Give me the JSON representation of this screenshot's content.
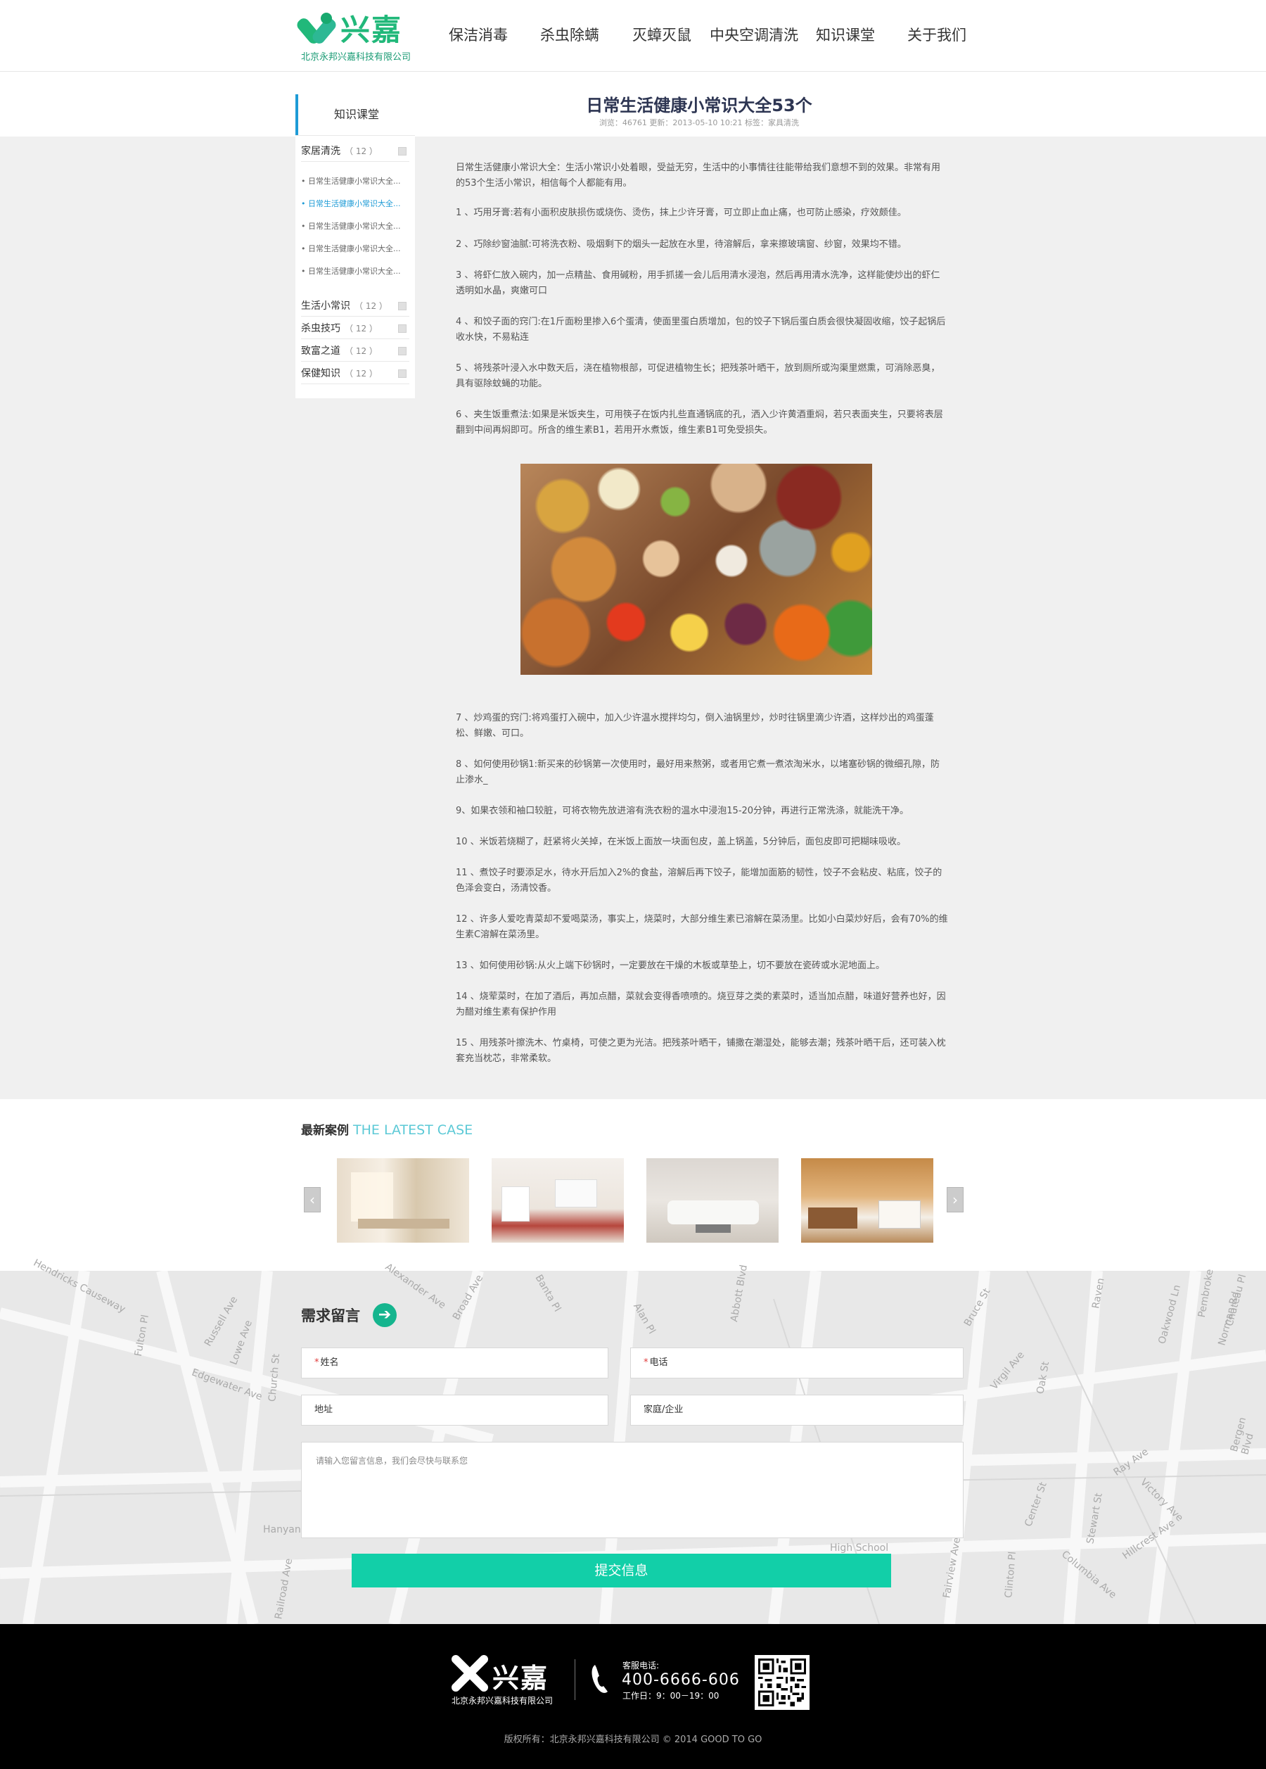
{
  "header": {
    "logo_text": "兴嘉",
    "logo_sub": "北京永邦兴嘉科技有限公司",
    "nav": [
      "保洁消毒",
      "杀虫除螨",
      "灭蟑灭鼠",
      "中央空调清洗",
      "知识课堂",
      "关于我们"
    ]
  },
  "sidebar": {
    "title": "知识课堂",
    "categories": [
      {
        "label": "家居清洗",
        "count": "（ 12 ）"
      },
      {
        "label": "生活小常识",
        "count": "（ 12 ）"
      },
      {
        "label": "杀虫技巧",
        "count": "（ 12 ）"
      },
      {
        "label": "致富之道",
        "count": "（ 12 ）"
      },
      {
        "label": "保健知识",
        "count": "（ 12 ）"
      }
    ],
    "sub_items": [
      "• 日常生活健康小常识大全...",
      "• 日常生活健康小常识大全...",
      "• 日常生活健康小常识大全...",
      "• 日常生活健康小常识大全...",
      "• 日常生活健康小常识大全..."
    ]
  },
  "article": {
    "title": "日常生活健康小常识大全53个",
    "meta": "浏览：46761   更新：2013-05-10 10:21   标签：家具清洗",
    "paragraphs": [
      "日常生活健康小常识大全：生活小常识小处着眼，受益无穷，生活中的小事情往往能带给我们意想不到的效果。非常有用的53个生活小常识，相信每个人都能有用。",
      "1 、巧用牙膏:若有小面积皮肤损伤或烧伤、烫伤，抹上少许牙膏，可立即止血止痛，也可防止感染，疗效颇佳。",
      "2 、巧除纱窗油腻:可将洗衣粉、吸烟剩下的烟头一起放在水里，待溶解后，拿来擦玻璃窗、纱窗，效果均不错。",
      "3 、将虾仁放入碗内，加一点精盐、食用碱粉，用手抓搓一会儿后用清水浸泡，然后再用清水洗净，这样能使炒出的虾仁透明如水晶，爽嫩可口",
      "4 、和饺子面的窍门:在1斤面粉里掺入6个蛋清，使面里蛋白质增加，包的饺子下锅后蛋白质会很快凝固收缩，饺子起锅后收水快，不易粘连",
      "5 、将残茶叶浸入水中数天后，浇在植物根部，可促进植物生长；把残茶叶晒干，放到厕所或沟渠里燃熏，可消除恶臭，具有驱除蚊蝇的功能。",
      "6 、夹生饭重煮法:如果是米饭夹生，可用筷子在饭内扎些直通锅底的孔，洒入少许黄酒重焖，若只表面夹生，只要将表层翻到中间再焖即可。所含的维生素B1，若用开水煮饭，维生素B1可免受损失。",
      "7 、炒鸡蛋的窍门:将鸡蛋打入碗中，加入少许温水搅拌均匀，倒入油锅里炒，炒时往锅里滴少许酒，这样炒出的鸡蛋蓬松、鲜嫩、可口。",
      "8 、如何使用砂锅1:新买来的砂锅第一次使用时，最好用来熬粥，或者用它煮一煮浓淘米水，以堵塞砂锅的微细孔隙，防止渗水_",
      "9、如果衣领和袖口较脏，可将衣物先放进溶有洗衣粉的温水中浸泡15-20分钟，再进行正常洗涤，就能洗干净。",
      "10 、米饭若烧糊了，赶紧将火关掉，在米饭上面放一块面包皮，盖上锅盖，5分钟后，面包皮即可把糊味吸收。",
      "11 、煮饺子时要添足水，待水开后加入2%的食盐，溶解后再下饺子，能增加面筋的韧性，饺子不会粘皮、粘底，饺子的色泽会变白，汤清饺香。",
      "12 、许多人爱吃青菜却不爱喝菜汤，事实上，烧菜时，大部分维生素已溶解在菜汤里。比如小白菜炒好后，会有70%的维生素C溶解在菜汤里。",
      "13 、如何使用砂锅:从火上端下砂锅时，一定要放在干燥的木板或草垫上，切不要放在瓷砖或水泥地面上。",
      "14 、烧荤菜时，在加了酒后，再加点醋，菜就会变得香喷喷的。烧豆芽之类的素菜时，适当加点醋，味道好营养也好，因为醋对维生素有保护作用",
      "15 、用残茶叶擦洗木、竹桌椅，可使之更为光洁。把残茶叶晒干，铺撒在潮湿处，能够去潮；残茶叶晒干后，还可装入枕套充当枕芯，非常柔软。"
    ]
  },
  "cases": {
    "title": "最新案例",
    "title_en": "THE LATEST CASE",
    "prev": "‹",
    "next": "›"
  },
  "form": {
    "title": "需求留言",
    "go_icon": "➔",
    "name_label": "姓名",
    "phone_label": "电话",
    "address_label": "地址",
    "type_label": "家庭/企业",
    "required_mark": "*",
    "message_placeholder": "请输入您留言信息，我们会尽快与联系您",
    "submit": "提交信息"
  },
  "footer": {
    "logo_text": "兴嘉",
    "logo_sub": "北京永邦兴嘉科技有限公司",
    "tel_label": "客服电话:",
    "tel": "400-6666-606",
    "hours": "工作日：9：00－19：00",
    "copyright": "版权所有：北京永邦兴嘉科技有限公司 © 2014 GOOD TO GO"
  },
  "map_labels": [
    "Hendricks Causeway",
    "Edgewater Ave",
    "Russell Ave",
    "Lowe Ave",
    "Fulton Pl",
    "Church St",
    "Broad Ave",
    "Alexander Ave",
    "Banta Pl",
    "Alan Pl",
    "Abbott Blvd",
    "Bruce St",
    "Virgil Ave",
    "Oakwood Ln",
    "Norman Rd",
    "Chateau Pl",
    "Bergen Blvd",
    "Ray Ave",
    "Victory Ave",
    "Hillcrest Ave",
    "Columbia Ave",
    "Stewart St",
    "Center St",
    "Oak St",
    "Clinton Pl",
    "Railroad Ave",
    "Hanyangma",
    "High School",
    "Fairview Ave",
    "Pembroke",
    "Raven"
  ]
}
